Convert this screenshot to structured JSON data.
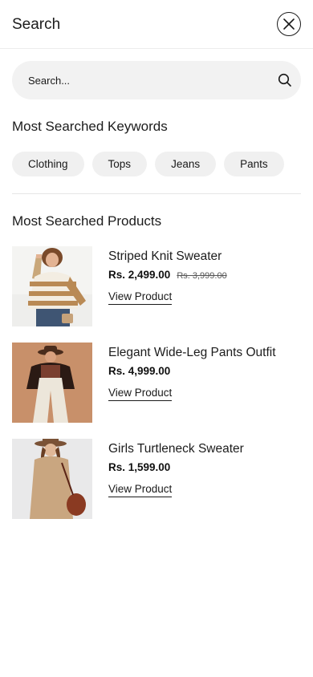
{
  "header": {
    "title": "Search",
    "close_icon": "close-icon"
  },
  "search": {
    "placeholder": "Search...",
    "icon": "search-icon"
  },
  "keywords": {
    "heading": "Most Searched Keywords",
    "items": [
      {
        "label": "Clothing"
      },
      {
        "label": "Tops"
      },
      {
        "label": "Jeans"
      },
      {
        "label": "Pants"
      }
    ]
  },
  "products": {
    "heading": "Most Searched Products",
    "items": [
      {
        "name": "Striped Knit Sweater",
        "price": "Rs. 2,499.00",
        "old_price": "Rs. 3,999.00",
        "link": "View Product"
      },
      {
        "name": "Elegant Wide-Leg Pants Outfit",
        "price": "Rs. 4,999.00",
        "old_price": "",
        "link": "View Product"
      },
      {
        "name": "Girls Turtleneck Sweater",
        "price": "Rs. 1,599.00",
        "old_price": "",
        "link": "View Product"
      }
    ]
  },
  "colors": {
    "chip_bg": "#f0f0f0",
    "search_bg": "#f2f2f2",
    "text": "#1a1a1a",
    "divider": "#e6e6e6"
  }
}
